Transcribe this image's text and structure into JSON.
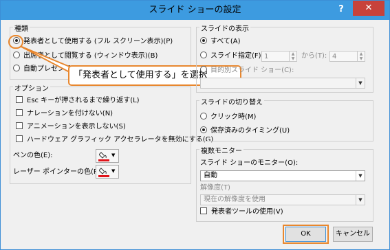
{
  "window": {
    "title": "スライド ショーの設定",
    "help": "?",
    "close": "✕"
  },
  "type_group": {
    "label": "種類",
    "options": [
      "発表者として使用する (フル スクリーン表示)(P)",
      "出席者として閲覧する (ウィンドウ表示)(B)",
      "自動プレゼンテーション"
    ],
    "selected": 0
  },
  "options_group": {
    "label": "オプション",
    "checks": [
      "Esc キーが押されるまで繰り返す(L)",
      "ナレーションを付けない(N)",
      "アニメーションを表示しない(S)",
      "ハードウェア グラフィック アクセラレータを無効にする(G)"
    ],
    "pen_color_label": "ペンの色(E):",
    "laser_color_label": "レーザー ポインターの色(R):"
  },
  "show_group": {
    "label": "スライドの表示",
    "all": "すべて(A)",
    "range": "スライド指定(F):",
    "from_value": "1",
    "to_label": "から(T):",
    "to_value": "4",
    "custom": "目的別スライド ショー(C):"
  },
  "advance_group": {
    "label": "スライドの切り替え",
    "manual": "クリック時(M)",
    "timings": "保存済みのタイミング(U)"
  },
  "monitor_group": {
    "label": "複数モニター",
    "monitor_label": "スライド ショーのモニター(O):",
    "monitor_value": "自動",
    "resolution_label": "解像度(T)",
    "resolution_value": "現在の解像度を使用",
    "presenter_view": "発表者ツールの使用(V)"
  },
  "buttons": {
    "ok": "OK",
    "cancel": "キャンセル"
  },
  "callout": "「発表者として使用する」を選択",
  "colors": {
    "titlebar": "#3d9be0",
    "close": "#c7423b",
    "highlight": "#e8872e",
    "pen": "#e0131a"
  }
}
